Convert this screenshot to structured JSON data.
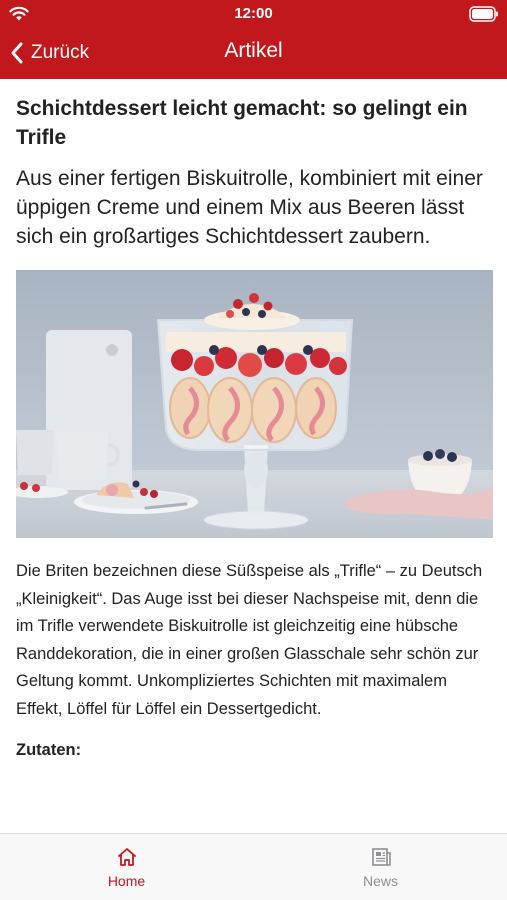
{
  "status_bar": {
    "time": "12:00",
    "background": "#c0181c"
  },
  "nav": {
    "back_label": "Zurück",
    "title": "Artikel"
  },
  "article": {
    "headline": "Schichtdessert leicht gemacht: so gelingt ein Trifle",
    "lead": "Aus einer fertigen Biskuitrolle, kombiniert mit einer üppigen Creme und einem Mix aus Beeren lässt sich ein großartiges Schichtdessert zaubern.",
    "body": "Die Briten bezeichnen diese Süßspeise als „Trifle“ – zu Deutsch „Kleinigkeit“. Das Auge isst bei dieser Nachspeise mit, denn die im Trifle verwendete Biskuitrolle ist gleichzeitig eine hübsche Randdekoration, die in einer großen Glasschale sehr schön zur Geltung kommt. Unkompliziertes Schichten mit maximalem Effekt, Löffel für Löffel ein Dessertgedicht.",
    "section_heading": "Zutaten:"
  },
  "tab_bar": {
    "items": [
      {
        "label": "Home",
        "icon": "home-icon",
        "active": true
      },
      {
        "label": "News",
        "icon": "news-icon",
        "active": false
      }
    ],
    "active_color": "#c0181c",
    "inactive_color": "#8e8e93"
  }
}
